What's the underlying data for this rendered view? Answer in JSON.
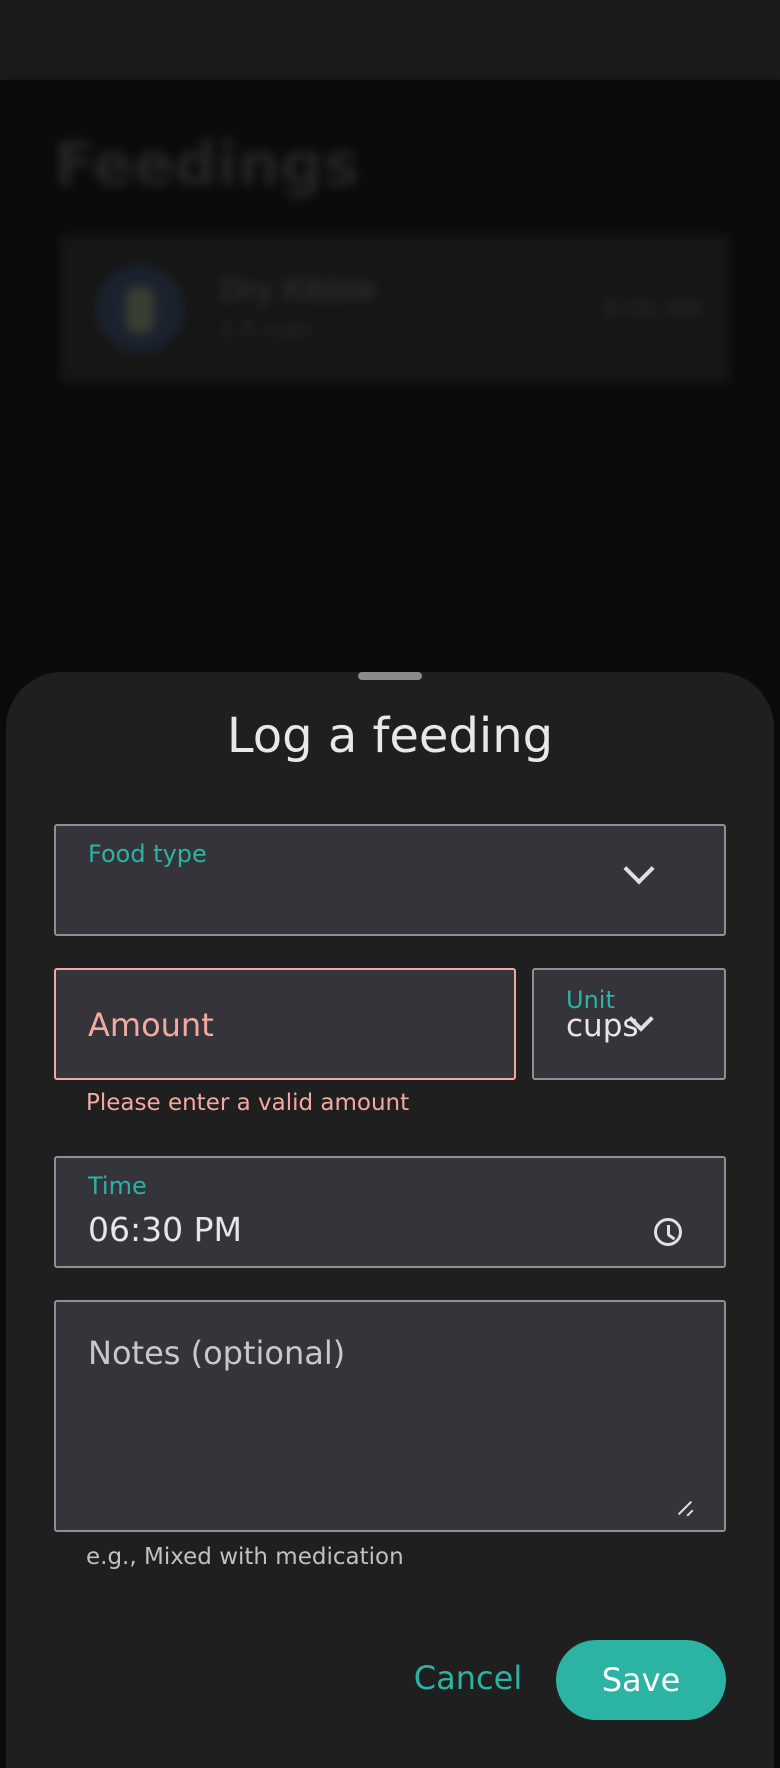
{
  "background": {
    "title": "Feedings",
    "card": {
      "name": "Dry Kibble",
      "amount": "1.5 cups",
      "time": "8:00 AM"
    }
  },
  "sheet": {
    "title": "Log a feeding",
    "food_type": {
      "label": "Food type",
      "value": ""
    },
    "amount": {
      "placeholder": "Amount",
      "error": "Please enter a valid amount"
    },
    "unit": {
      "label": "Unit",
      "value": "cups"
    },
    "time": {
      "label": "Time",
      "value": "06:30 PM"
    },
    "notes": {
      "placeholder": "Notes (optional)",
      "helper": "e.g., Mixed with medication"
    },
    "actions": {
      "cancel": "Cancel",
      "save": "Save"
    }
  },
  "colors": {
    "accent": "#2bb3a3",
    "error": "#f4a9a0",
    "sheet_bg": "#1f1f20",
    "field_bg": "#35343b"
  }
}
